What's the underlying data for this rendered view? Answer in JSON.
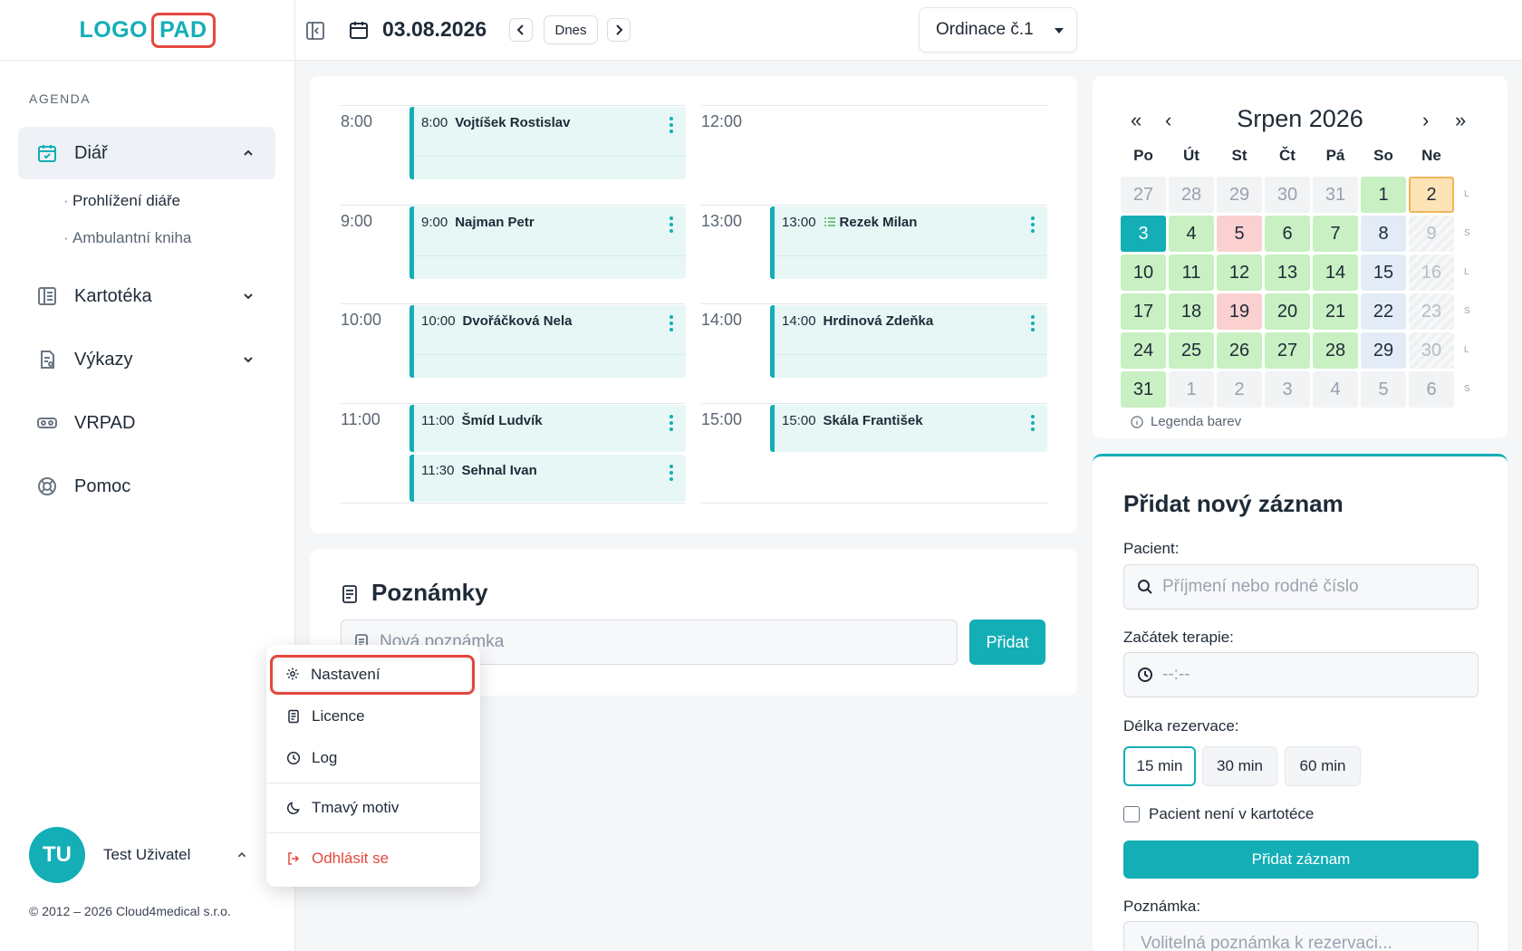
{
  "brand": {
    "logo_left": "LOGO",
    "logo_right": "PAD"
  },
  "sidebar": {
    "section": "AGENDA",
    "items": [
      {
        "label": "Diář",
        "icon": "calendar-check-icon"
      },
      {
        "label": "Kartotéka",
        "icon": "card-index-icon"
      },
      {
        "label": "Výkazy",
        "icon": "report-icon"
      },
      {
        "label": "VRPAD",
        "icon": "vr-headset-icon"
      },
      {
        "label": "Pomoc",
        "icon": "lifebuoy-icon"
      }
    ],
    "subitems": [
      "Prohlížení diáře",
      "Ambulantní kniha"
    ]
  },
  "user": {
    "initials": "TU",
    "name": "Test Uživatel"
  },
  "copyright": "© 2012 – 2026 Cloud4medical s.r.o.",
  "header": {
    "date": "03.08.2026",
    "today": "Dnes",
    "clinic": "Ordinace č.1"
  },
  "schedule": {
    "hours_left": [
      "8:00",
      "9:00",
      "10:00",
      "11:00"
    ],
    "hours_right": [
      "12:00",
      "13:00",
      "14:00",
      "15:00"
    ],
    "appointments": [
      {
        "time": "8:00",
        "name": "Vojtíšek Rostislav"
      },
      {
        "time": "9:00",
        "name": "Najman Petr"
      },
      {
        "time": "10:00",
        "name": "Dvořáčková Nela"
      },
      {
        "time": "11:00",
        "name": "Šmíd Ludvík"
      },
      {
        "time": "11:30",
        "name": "Sehnal Ivan"
      },
      {
        "time": "13:00",
        "name": "Rezek Milan"
      },
      {
        "time": "14:00",
        "name": "Hrdinová Zdeňka"
      },
      {
        "time": "15:00",
        "name": "Skála František"
      }
    ]
  },
  "notes": {
    "title": "Poznámky",
    "placeholder": "Nová poznámka",
    "add": "Přidat"
  },
  "calendar": {
    "title": "Srpen 2026",
    "nav": {
      "first": "«",
      "prev": "‹",
      "next": "›",
      "last": "»"
    },
    "dow": [
      "Po",
      "Út",
      "St",
      "Čt",
      "Pá",
      "So",
      "Ne"
    ],
    "weeks": [
      [
        "27",
        "28",
        "29",
        "30",
        "31",
        "1",
        "2"
      ],
      [
        "3",
        "4",
        "5",
        "6",
        "7",
        "8",
        "9"
      ],
      [
        "10",
        "11",
        "12",
        "13",
        "14",
        "15",
        "16"
      ],
      [
        "17",
        "18",
        "19",
        "20",
        "21",
        "22",
        "23"
      ],
      [
        "24",
        "25",
        "26",
        "27",
        "28",
        "29",
        "30"
      ],
      [
        "31",
        "1",
        "2",
        "3",
        "4",
        "5",
        "6"
      ]
    ],
    "week_marks": [
      "L",
      "S",
      "L",
      "S",
      "L",
      "S"
    ],
    "legend": "Legenda barev",
    "colors": {
      "available": "#c8f0c2",
      "full": "#fbd0d0",
      "saturday": "#e3ecf6",
      "today": "#13aeb6",
      "selected": "#fde3b5"
    }
  },
  "form": {
    "title": "Přidat nový záznam",
    "patient_label": "Pacient:",
    "patient_placeholder": "Příjmení nebo rodné číslo",
    "start_label": "Začátek terapie:",
    "start_placeholder": "--:--",
    "duration_label": "Délka rezervace:",
    "durations": [
      "15 min",
      "30 min",
      "60 min"
    ],
    "not_in_registry": "Pacient není v kartotéce",
    "submit": "Přidat záznam",
    "note_label": "Poznámka:",
    "note_placeholder": "Volitelná poznámka k rezervaci..."
  },
  "menu": {
    "items": [
      "Nastavení",
      "Licence",
      "Log",
      "Tmavý motiv",
      "Odhlásit se"
    ]
  },
  "accent": "#13aeb6",
  "danger": "#e5483f"
}
